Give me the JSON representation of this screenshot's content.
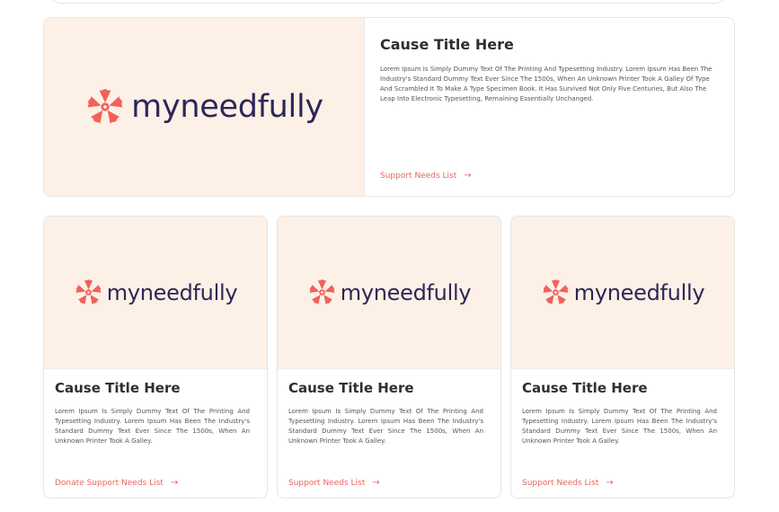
{
  "brand": {
    "name": "myneedfully",
    "text_color": "#2d2658",
    "mark_color": "#f0625c",
    "media_background": "#fdf0e6"
  },
  "accent_color": "#e8655d",
  "featured": {
    "title": "Cause Title Here",
    "description": "Lorem Ipsum Is Simply Dummy Text Of The Printing And Typesetting Industry. Lorem Ipsum Has Been The Industry's Standard Dummy Text Ever Since The 1500s, When An Unknown Printer Took A Galley Of Type And Scrambled It To Make A Type Specimen Book. It Has Survived Not Only Five Centuries, But Also The Leap Into Electronic Typesetting, Remaining Essentially Unchanged.",
    "link_label": "Support Needs List",
    "link_icon": "arrow-right-icon"
  },
  "cards": [
    {
      "title": "Cause Title Here",
      "description": "Lorem Ipsum Is Simply Dummy Text Of The Printing And Typesetting Industry. Lorem Ipsum Has Been The Industry's Standard Dummy Text Ever Since The 1500s, When An Unknown Printer Took A Galley.",
      "link_label": "Donate Support Needs List"
    },
    {
      "title": "Cause Title Here",
      "description": "Lorem Ipsum Is Simply Dummy Text Of The Printing And Typesetting Industry. Lorem Ipsum Has Been The Industry's Standard Dummy Text Ever Since The 1500s, When An Unknown Printer Took A Galley.",
      "link_label": "Support Needs List"
    },
    {
      "title": "Cause Title Here",
      "description": "Lorem Ipsum Is Simply Dummy Text Of The Printing And Typesetting Industry. Lorem Ipsum Has Been The Industry's Standard Dummy Text Ever Since The 1500s, When An Unknown Printer Took A Galley.",
      "link_label": "Support Needs List"
    }
  ]
}
